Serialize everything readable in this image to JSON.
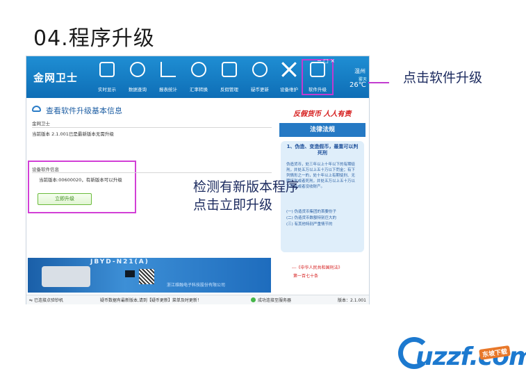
{
  "slide": {
    "title": "04.程序升级"
  },
  "app": {
    "name": "金网卫士",
    "toolbar": [
      {
        "label": "实时显示",
        "icon": "monitor-icon"
      },
      {
        "label": "数据查询",
        "icon": "search-icon"
      },
      {
        "label": "报表统计",
        "icon": "chart-icon"
      },
      {
        "label": "汇率转换",
        "icon": "currency-exchange-icon"
      },
      {
        "label": "反假管理",
        "icon": "anti-counterfeit-icon"
      },
      {
        "label": "疑币更新",
        "icon": "update-icon"
      },
      {
        "label": "设备维护",
        "icon": "tools-icon"
      },
      {
        "label": "软件升级",
        "icon": "upgrade-icon"
      }
    ],
    "window_controls": "−  □  ×",
    "weather": {
      "city": "温州",
      "sub": "雾天",
      "temp": "26℃"
    },
    "software_section": {
      "title": "查看软件升级基本信息",
      "product": "金网卫士",
      "current": "当前版本 2.1.001已是最新版本无需升级"
    },
    "device_section": {
      "title": "设备软件信息",
      "current": "当前版本:00600020，有新版本可以升级",
      "button": "立即升级"
    },
    "ad": {
      "slogan": "反假货币 人人有责",
      "banner": "法律法规",
      "heading": "1、伪造、变造假币，最重可以判死刑",
      "body": "伪造货币，处三年以上十年以下的有期徒刑，并处五万以上五十万以下罚金；有下列情形之一的，处十年以上有期徒刑、无期徒刑或者死刑，并处五万以上五十万以下罚金或者没收财产。",
      "list": [
        "(一) 伪造货币集团的首要份子",
        "(二) 伪造货币数额特别巨大的",
        "(三) 有其他特别严重情节的"
      ],
      "source": "---《中华人民共和国刑法》",
      "article": "第一百七十条"
    },
    "product_banner": {
      "model": "JBYD-N21(A)",
      "company": "浙江维融电子科技股份有限公司"
    },
    "statusbar": {
      "usb": "已连接点验钞机",
      "notice": "疑币数据有最新版本,请到【疑币更新】菜单及时更新！",
      "server": "成功连接至服务器",
      "version": "版本：2.1.001"
    }
  },
  "annotations": {
    "click_upgrade": "点击软件升级",
    "detect_line1": "检测有新版本程序",
    "detect_line2": "点击立即升级"
  },
  "watermark": {
    "logo": "uzzf.com",
    "badge": "东坡下载"
  },
  "colors": {
    "toolbar": "#1378c4",
    "highlight": "#c23bd0",
    "annotation_text": "#1b2a5e",
    "alert_red": "#d51a1a"
  }
}
